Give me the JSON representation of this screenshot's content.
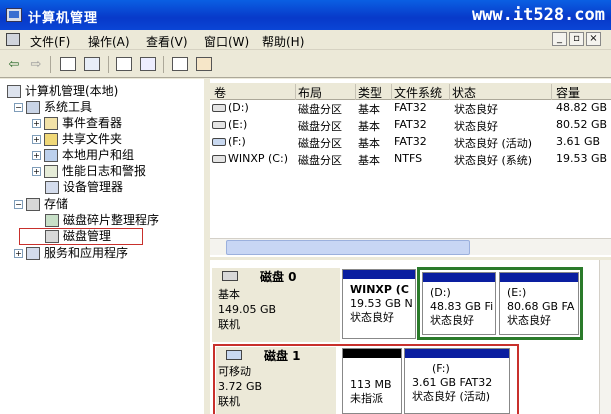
{
  "window": {
    "title": "计算机管理",
    "watermark": "www.it528.com"
  },
  "menu": {
    "file": "文件(F)",
    "action": "操作(A)",
    "view": "查看(V)",
    "window": "窗口(W)",
    "help": "帮助(H)"
  },
  "window_controls": {
    "minimize": "_",
    "restore": "▫",
    "close": "×"
  },
  "tree": {
    "root": "计算机管理(本地)",
    "system_tools": "系统工具",
    "event_viewer": "事件查看器",
    "shared_folders": "共享文件夹",
    "local_users": "本地用户和组",
    "perf_logs": "性能日志和警报",
    "device_manager": "设备管理器",
    "storage": "存储",
    "defrag": "磁盘碎片整理程序",
    "disk_mgmt": "磁盘管理",
    "services_apps": "服务和应用程序"
  },
  "volume_table": {
    "headers": {
      "volume": "卷",
      "layout": "布局",
      "type": "类型",
      "fs": "文件系统",
      "status": "状态",
      "capacity": "容量"
    },
    "rows": [
      {
        "volume": "(D:)",
        "layout": "磁盘分区",
        "type": "基本",
        "fs": "FAT32",
        "status": "状态良好",
        "capacity": "48.82 GB"
      },
      {
        "volume": "(E:)",
        "layout": "磁盘分区",
        "type": "基本",
        "fs": "FAT32",
        "status": "状态良好",
        "capacity": "80.52 GB"
      },
      {
        "volume": "(F:)",
        "layout": "磁盘分区",
        "type": "基本",
        "fs": "FAT32",
        "status": "状态良好 (活动)",
        "capacity": "3.61 GB"
      },
      {
        "volume": "WINXP (C:)",
        "layout": "磁盘分区",
        "type": "基本",
        "fs": "NTFS",
        "status": "状态良好 (系统)",
        "capacity": "19.53 GB"
      }
    ]
  },
  "disks": [
    {
      "name": "磁盘 0",
      "type": "基本",
      "size": "149.05 GB",
      "state": "联机",
      "partitions": [
        {
          "line1": "WINXP  (C",
          "line2": "19.53 GB N",
          "line3": "状态良好"
        },
        {
          "line1": "(D:)",
          "line2": "48.83 GB Fi",
          "line3": "状态良好"
        },
        {
          "line1": "(E:)",
          "line2": "80.68 GB FA",
          "line3": "状态良好"
        }
      ]
    },
    {
      "name": "磁盘 1",
      "type": "可移动",
      "size": "3.72 GB",
      "state": "联机",
      "partitions": [
        {
          "line1": "",
          "line2": "113 MB",
          "line3": "未指派"
        },
        {
          "line1": "(F:)",
          "line2": "3.61 GB FAT32",
          "line3": "状态良好 (活动)"
        }
      ]
    }
  ],
  "colors": {
    "title_bar": "#0a45d6",
    "primary_band": "#0a1ea0",
    "unallocated_band": "#000000",
    "selection_green": "#2a7a2a",
    "highlight_red": "#c8302c"
  }
}
